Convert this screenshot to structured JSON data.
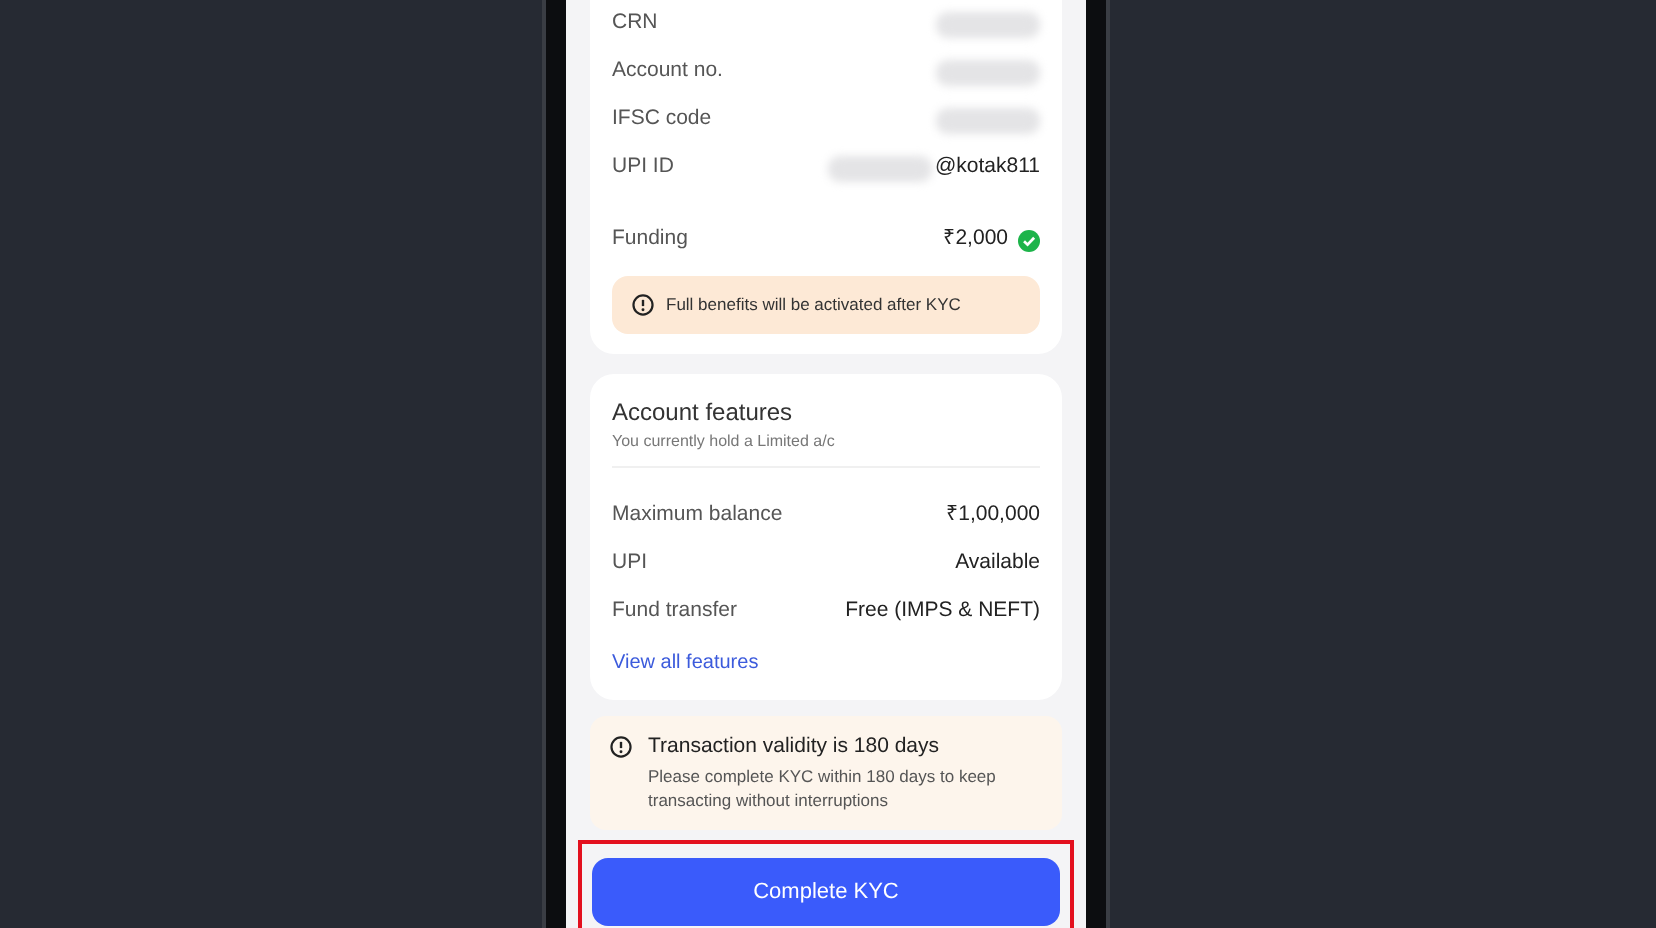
{
  "account_details": {
    "rows": [
      {
        "label": "CRN",
        "redacted": true
      },
      {
        "label": "Account no.",
        "redacted": true
      },
      {
        "label": "IFSC code",
        "redacted": true
      },
      {
        "label": "UPI ID",
        "value": "@kotak811",
        "redacted": true
      }
    ],
    "funding": {
      "label": "Funding",
      "value": "₹2,000",
      "verified": true
    },
    "notice": "Full benefits will be activated after KYC"
  },
  "account_features": {
    "title": "Account features",
    "subtitle": "You currently hold a Limited a/c",
    "rows": [
      {
        "label": "Maximum balance",
        "value": "₹1,00,000"
      },
      {
        "label": "UPI",
        "value": "Available"
      },
      {
        "label": "Fund transfer",
        "value": "Free (IMPS & NEFT)"
      }
    ],
    "link": "View all features"
  },
  "validity_notice": {
    "title": "Transaction validity is 180 days",
    "text": "Please complete KYC within 180 days to keep transacting without interruptions"
  },
  "primary_button": {
    "label": "Complete KYC",
    "highlighted": true
  }
}
